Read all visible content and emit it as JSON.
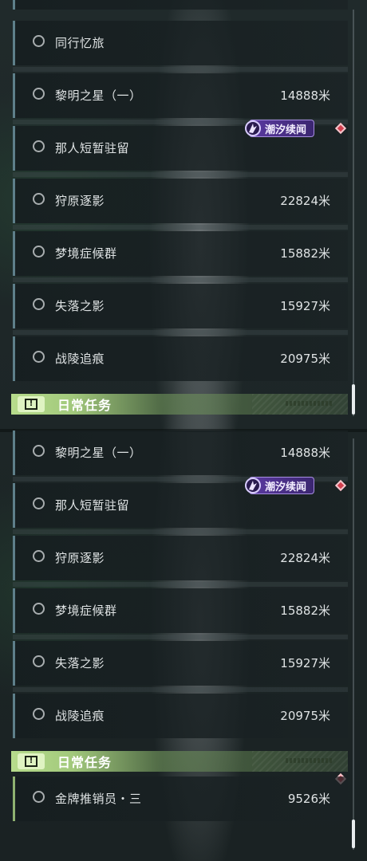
{
  "icons": {
    "status": "circle-outline-icon",
    "event": "flame-spark-icon",
    "warning": "exclamation-box-icon",
    "alert": "diamond-marker-icon"
  },
  "colors": {
    "accent_green": "#b7dc8c",
    "row_bar": "#5e7f8a",
    "badge_purple": "#5b3aa1",
    "alert_red": "#d2404f"
  },
  "panel1": {
    "quests": [
      {
        "name": "同行忆旅",
        "distance": ""
      },
      {
        "name": "黎明之星（一）",
        "distance": "14888米"
      },
      {
        "name": "那人短暂驻留",
        "distance": ""
      },
      {
        "name": "狩原逐影",
        "distance": "22824米"
      },
      {
        "name": "梦境症候群",
        "distance": "15882米"
      },
      {
        "name": "失落之影",
        "distance": "15927米"
      },
      {
        "name": "战陵追痕",
        "distance": "20975米"
      }
    ],
    "badge_label": "潮汐续闻",
    "section_title": "日常任务"
  },
  "panel2": {
    "quests": [
      {
        "name": "黎明之星（一）",
        "distance": "14888米"
      },
      {
        "name": "那人短暂驻留",
        "distance": ""
      },
      {
        "name": "狩原逐影",
        "distance": "22824米"
      },
      {
        "name": "梦境症候群",
        "distance": "15882米"
      },
      {
        "name": "失落之影",
        "distance": "15927米"
      },
      {
        "name": "战陵追痕",
        "distance": "20975米"
      }
    ],
    "badge_label": "潮汐续闻",
    "section_title": "日常任务",
    "daily_quests": [
      {
        "name": "金牌推销员・三",
        "distance": "9526米"
      }
    ]
  }
}
